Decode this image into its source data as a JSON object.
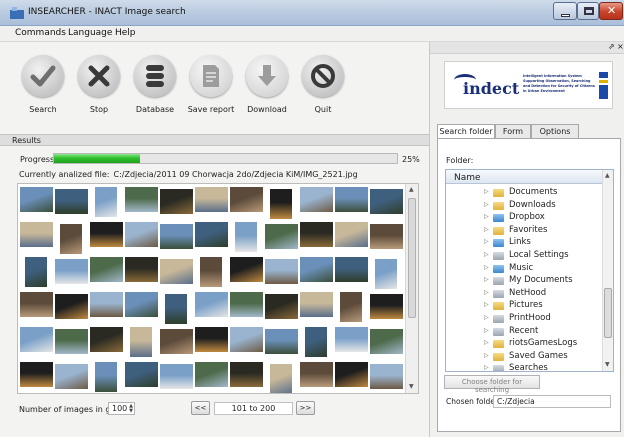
{
  "window": {
    "title": "INSEARCHER - INACT Image search"
  },
  "menu": [
    "Commands",
    "Language",
    "Help"
  ],
  "toolbar": [
    {
      "label": "Search",
      "icon": "check-icon",
      "enabled": true
    },
    {
      "label": "Stop",
      "icon": "x-icon",
      "enabled": true
    },
    {
      "label": "Database",
      "icon": "database-icon",
      "enabled": true
    },
    {
      "label": "Save report",
      "icon": "report-icon",
      "enabled": false
    },
    {
      "label": "Download",
      "icon": "download-arrow-icon",
      "enabled": false
    },
    {
      "label": "Quit",
      "icon": "no-entry-icon",
      "enabled": true
    }
  ],
  "results": {
    "header": "Results",
    "progress_label": "Progress:",
    "progress_fraction": 0.25,
    "progress_text": "25%",
    "current_file_label": "Currently analized file:",
    "current_file": "C:/Zdjecia/2011 09 Chorwacja 2do/Zdjecia KiM/IMG_2521.jpg",
    "thumbnail_count": 66
  },
  "grid_controls": {
    "count_label": "Number of images in grid:",
    "count_value": "100",
    "prev_label": "<<",
    "next_label": ">>",
    "range_text": "101 to 200"
  },
  "right_panel": {
    "logo_text": "indect",
    "logo_tagline": "Intelligent Information System Supporting Observation, Searching and Detection for Security of Citizens in Urban Environment",
    "tabs": [
      "Search folder",
      "Form",
      "Options"
    ],
    "active_tab": 0,
    "folder_label": "Folder:",
    "tree_header": "Name",
    "folders": [
      {
        "name": "Documents",
        "icon": "folder"
      },
      {
        "name": "Downloads",
        "icon": "folder"
      },
      {
        "name": "Dropbox",
        "icon": "folder-blue"
      },
      {
        "name": "Favorites",
        "icon": "folder"
      },
      {
        "name": "Links",
        "icon": "folder-blue"
      },
      {
        "name": "Local Settings",
        "icon": "folder-gray"
      },
      {
        "name": "Music",
        "icon": "folder-blue"
      },
      {
        "name": "My Documents",
        "icon": "folder-gray"
      },
      {
        "name": "NetHood",
        "icon": "folder-gray"
      },
      {
        "name": "Pictures",
        "icon": "folder"
      },
      {
        "name": "PrintHood",
        "icon": "folder-gray"
      },
      {
        "name": "Recent",
        "icon": "folder-gray"
      },
      {
        "name": "riotsGamesLogs",
        "icon": "folder"
      },
      {
        "name": "Saved Games",
        "icon": "folder"
      },
      {
        "name": "Searches",
        "icon": "folder-gray"
      }
    ],
    "choose_button": "Choose folder for searching",
    "chosen_label": "Chosen folder:",
    "chosen_value": "C:/Zdjecia"
  },
  "colors": {
    "progress": "#2fbf2f",
    "logo_blue": "#1a2e7a"
  }
}
